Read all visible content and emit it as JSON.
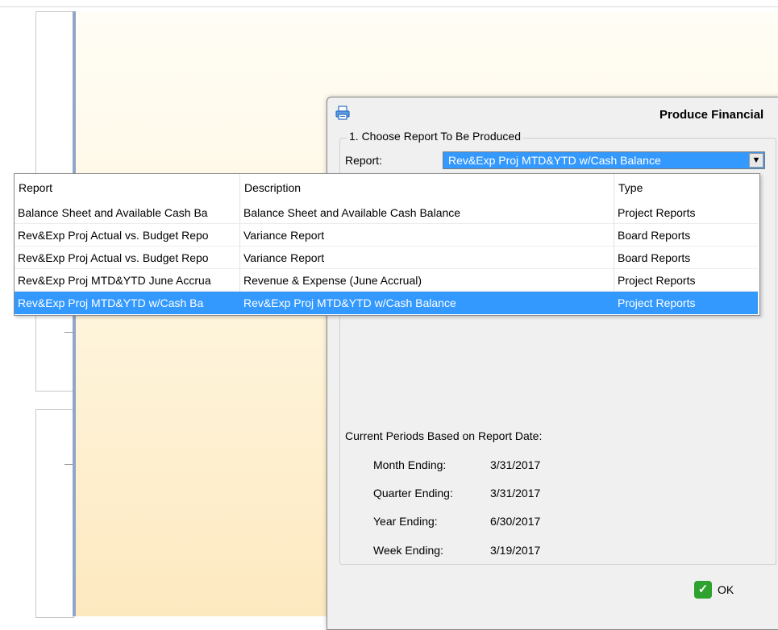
{
  "dialog": {
    "title": "Produce Financial",
    "title_icon": "printer-icon",
    "section_title": "1. Choose Report To Be Produced",
    "report_label": "Report:",
    "report_selected": "Rev&Exp Proj MTD&YTD w/Cash Balance",
    "periods_title": "Current Periods Based on Report Date:",
    "periods": [
      {
        "label": "Month Ending:",
        "value": "3/31/2017"
      },
      {
        "label": "Quarter Ending:",
        "value": "3/31/2017"
      },
      {
        "label": "Year Ending:",
        "value": "6/30/2017"
      },
      {
        "label": "Week Ending:",
        "value": "3/19/2017"
      }
    ],
    "ok_label": "OK"
  },
  "dropdown": {
    "columns": [
      "Report",
      "Description",
      "Type"
    ],
    "rows": [
      {
        "report": "Balance Sheet and Available Cash Ba",
        "description": "Balance Sheet and Available Cash Balance",
        "type": "Project Reports"
      },
      {
        "report": "Rev&Exp Proj Actual vs. Budget Repo",
        "description": "Variance Report",
        "type": "Board Reports"
      },
      {
        "report": "Rev&Exp Proj Actual vs. Budget Repo",
        "description": "Variance Report",
        "type": "Board Reports"
      },
      {
        "report": "Rev&Exp Proj MTD&YTD June Accrua",
        "description": "Revenue & Expense (June Accrual)",
        "type": "Project Reports"
      },
      {
        "report": "Rev&Exp Proj MTD&YTD w/Cash Ba",
        "description": "Rev&Exp Proj MTD&YTD w/Cash Balance",
        "type": "Project Reports"
      }
    ],
    "selected_index": 4
  },
  "colors": {
    "selection": "#3399ff",
    "ok_check": "#2ea12e"
  }
}
